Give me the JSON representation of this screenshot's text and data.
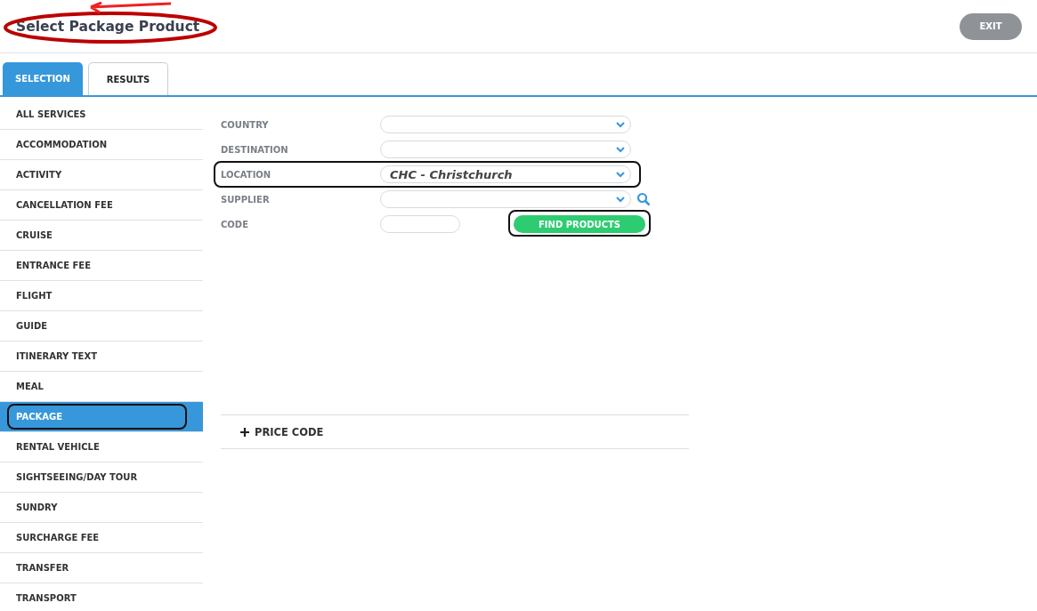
{
  "header": {
    "title": "Select Package Product",
    "title_circled": true,
    "exit_label": "EXIT"
  },
  "tabs": [
    {
      "label": "SELECTION",
      "selected": true
    },
    {
      "label": "RESULTS",
      "selected": false
    }
  ],
  "sidebar": {
    "items": [
      {
        "label": "ALL SERVICES",
        "selected": false,
        "outlined": false
      },
      {
        "label": "ACCOMMODATION",
        "selected": false,
        "outlined": false
      },
      {
        "label": "ACTIVITY",
        "selected": false,
        "outlined": false
      },
      {
        "label": "CANCELLATION FEE",
        "selected": false,
        "outlined": false
      },
      {
        "label": "CRUISE",
        "selected": false,
        "outlined": false
      },
      {
        "label": "ENTRANCE FEE",
        "selected": false,
        "outlined": false
      },
      {
        "label": "FLIGHT",
        "selected": false,
        "outlined": false
      },
      {
        "label": "GUIDE",
        "selected": false,
        "outlined": false
      },
      {
        "label": "ITINERARY TEXT",
        "selected": false,
        "outlined": false
      },
      {
        "label": "MEAL",
        "selected": false,
        "outlined": false
      },
      {
        "label": "PACKAGE",
        "selected": true,
        "outlined": true
      },
      {
        "label": "RENTAL VEHICLE",
        "selected": false,
        "outlined": false
      },
      {
        "label": "SIGHTSEEING/DAY TOUR",
        "selected": false,
        "outlined": false
      },
      {
        "label": "SUNDRY",
        "selected": false,
        "outlined": false
      },
      {
        "label": "SURCHARGE FEE",
        "selected": false,
        "outlined": false
      },
      {
        "label": "TRANSFER",
        "selected": false,
        "outlined": false
      },
      {
        "label": "TRANSPORT",
        "selected": false,
        "outlined": false
      }
    ]
  },
  "form": {
    "fields": [
      {
        "label": "COUNTRY",
        "kind": "select",
        "search": false,
        "outlined": false
      },
      {
        "label": "DESTINATION",
        "kind": "select",
        "search": false,
        "outlined": false
      },
      {
        "label": "LOCATION",
        "kind": "select",
        "value": "CHC - Christchurch",
        "search": false,
        "outlined": true
      },
      {
        "label": "SUPPLIER",
        "kind": "select",
        "search": true,
        "outlined": false
      },
      {
        "label": "CODE",
        "kind": "text",
        "search": false,
        "outlined": false
      }
    ],
    "find_button": {
      "label": "FIND PRODUCTS",
      "outlined": true
    }
  },
  "price_code": {
    "label": "PRICE CODE",
    "expanded": false
  }
}
